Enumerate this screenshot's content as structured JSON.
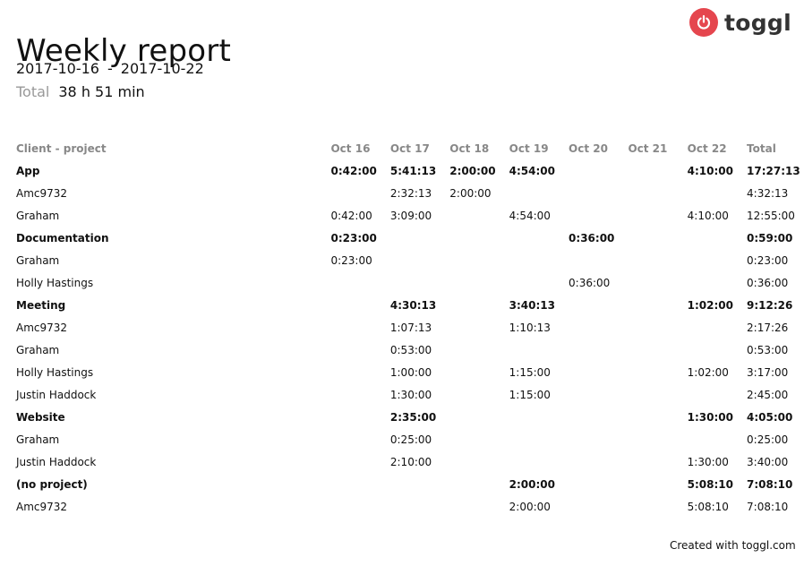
{
  "header": {
    "title": "Weekly report",
    "start_date": "2017-10-16",
    "separator": "-",
    "end_date": "2017-10-22",
    "total_label": "Total",
    "total_value": "38 h 51 min"
  },
  "logo": {
    "text": "toggl",
    "icon": "power-icon",
    "color": "#e5464e"
  },
  "table": {
    "columns": [
      "Client - project",
      "Oct 16",
      "Oct 17",
      "Oct 18",
      "Oct 19",
      "Oct 20",
      "Oct 21",
      "Oct 22",
      "Total"
    ],
    "rows": [
      {
        "type": "group",
        "cells": [
          "App",
          "0:42:00",
          "5:41:13",
          "2:00:00",
          "4:54:00",
          "",
          "",
          "4:10:00",
          "17:27:13"
        ]
      },
      {
        "type": "item",
        "cells": [
          "Amc9732",
          "",
          "2:32:13",
          "2:00:00",
          "",
          "",
          "",
          "",
          "4:32:13"
        ]
      },
      {
        "type": "item",
        "cells": [
          "Graham",
          "0:42:00",
          "3:09:00",
          "",
          "4:54:00",
          "",
          "",
          "4:10:00",
          "12:55:00"
        ]
      },
      {
        "type": "group",
        "cells": [
          "Documentation",
          "0:23:00",
          "",
          "",
          "",
          "0:36:00",
          "",
          "",
          "0:59:00"
        ]
      },
      {
        "type": "item",
        "cells": [
          "Graham",
          "0:23:00",
          "",
          "",
          "",
          "",
          "",
          "",
          "0:23:00"
        ]
      },
      {
        "type": "item",
        "cells": [
          "Holly Hastings",
          "",
          "",
          "",
          "",
          "0:36:00",
          "",
          "",
          "0:36:00"
        ]
      },
      {
        "type": "group",
        "cells": [
          "Meeting",
          "",
          "4:30:13",
          "",
          "3:40:13",
          "",
          "",
          "1:02:00",
          "9:12:26"
        ]
      },
      {
        "type": "item",
        "cells": [
          "Amc9732",
          "",
          "1:07:13",
          "",
          "1:10:13",
          "",
          "",
          "",
          "2:17:26"
        ]
      },
      {
        "type": "item",
        "cells": [
          "Graham",
          "",
          "0:53:00",
          "",
          "",
          "",
          "",
          "",
          "0:53:00"
        ]
      },
      {
        "type": "item",
        "cells": [
          "Holly Hastings",
          "",
          "1:00:00",
          "",
          "1:15:00",
          "",
          "",
          "1:02:00",
          "3:17:00"
        ]
      },
      {
        "type": "item",
        "cells": [
          "Justin Haddock",
          "",
          "1:30:00",
          "",
          "1:15:00",
          "",
          "",
          "",
          "2:45:00"
        ]
      },
      {
        "type": "group",
        "cells": [
          "Website",
          "",
          "2:35:00",
          "",
          "",
          "",
          "",
          "1:30:00",
          "4:05:00"
        ]
      },
      {
        "type": "item",
        "cells": [
          "Graham",
          "",
          "0:25:00",
          "",
          "",
          "",
          "",
          "",
          "0:25:00"
        ]
      },
      {
        "type": "item",
        "cells": [
          "Justin Haddock",
          "",
          "2:10:00",
          "",
          "",
          "",
          "",
          "1:30:00",
          "3:40:00"
        ]
      },
      {
        "type": "group",
        "cells": [
          "(no project)",
          "",
          "",
          "",
          "2:00:00",
          "",
          "",
          "5:08:10",
          "7:08:10"
        ]
      },
      {
        "type": "item",
        "cells": [
          "Amc9732",
          "",
          "",
          "",
          "2:00:00",
          "",
          "",
          "5:08:10",
          "7:08:10"
        ]
      }
    ]
  },
  "footer": {
    "text": "Created with toggl.com"
  }
}
